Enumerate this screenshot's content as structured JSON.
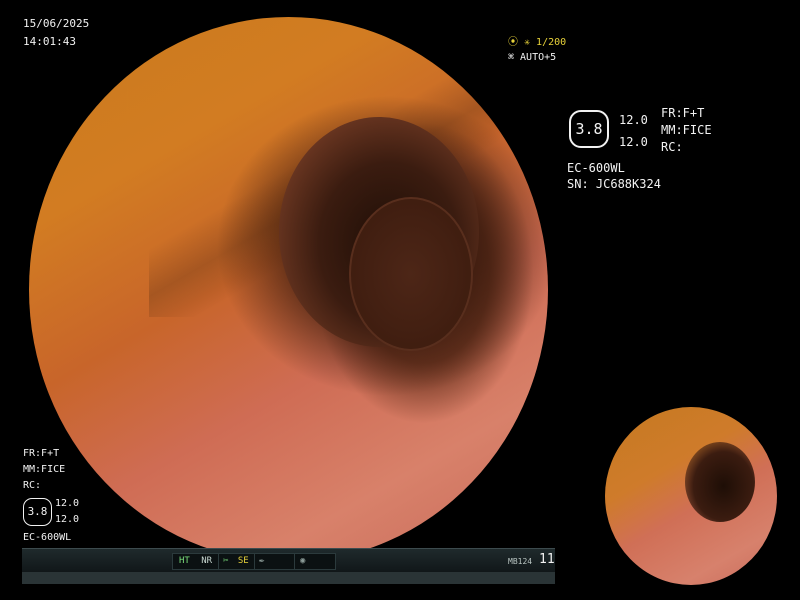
{
  "timestamp": {
    "date": "15/06/2025",
    "time": "14:01:43"
  },
  "top_right_status": {
    "shutter": "⦿ ✳ 1/200",
    "iris": "⌘ AUTO+5"
  },
  "info_panel": {
    "hex_value": "3.8",
    "value_1": "12.0",
    "value_2": "12.0",
    "fr": "FR:F+T",
    "mm": "MM:FICE",
    "rc": "RC:",
    "scope_model": "EC-600WL",
    "serial": "SN: JC688K324"
  },
  "bottom_left_panel": {
    "fr": "FR:F+T",
    "mm": "MM:FICE",
    "rc": "RC:",
    "hex_value": "3.8",
    "value_1": "12.0",
    "value_2": "12.0",
    "scope_model": "EC-600WL"
  },
  "status_bar": {
    "ht": "HT",
    "nr": "NR",
    "se": "SE",
    "mb_code": "MB124",
    "page_number": "11"
  },
  "colors": {
    "accent_yellow": "#e8d23a",
    "accent_green": "#7be07b",
    "text": "#f2f2f2"
  }
}
